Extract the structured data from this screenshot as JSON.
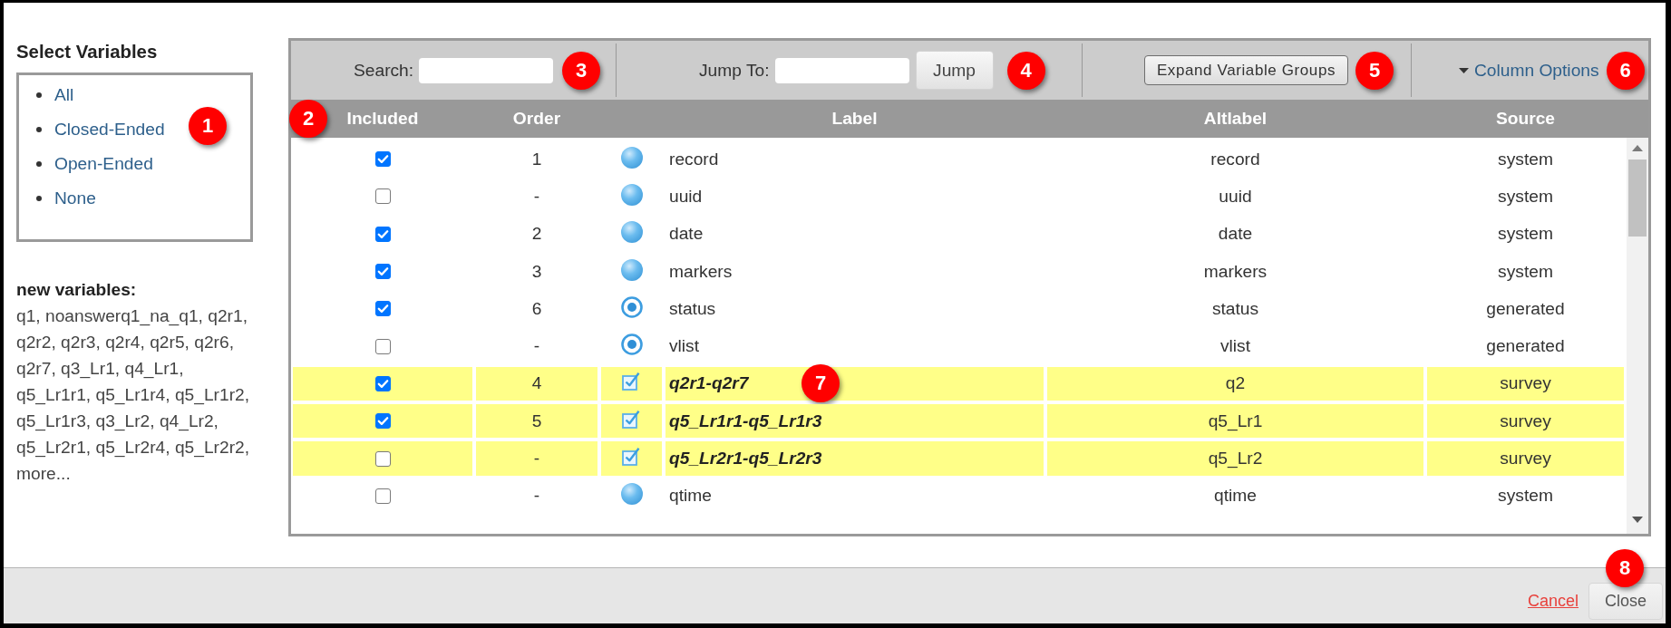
{
  "left_panel": {
    "title": "Select Variables",
    "filters": [
      "All",
      "Closed-Ended",
      "Open-Ended",
      "None"
    ],
    "callout": "1",
    "new_variables_title": "new variables:",
    "new_variables": "q1, noanswerq1_na_q1, q2r1, q2r2, q2r3, q2r4, q2r5, q2r6, q2r7, q3_Lr1, q4_Lr1, q5_Lr1r1, q5_Lr1r4, q5_Lr1r2, q5_Lr1r3, q3_Lr2, q4_Lr2, q5_Lr2r1, q5_Lr2r4, q5_Lr2r2, more..."
  },
  "toolbar": {
    "search": {
      "label": "Search:",
      "callout": "3"
    },
    "jump": {
      "label": "Jump To:",
      "button": "Jump",
      "callout": "4"
    },
    "expand_button": {
      "label": "Expand Variable Groups",
      "callout": "5"
    },
    "column_options": {
      "label": "Column Options",
      "callout": "6"
    }
  },
  "table": {
    "callout": "2",
    "columns": [
      "Included",
      "Order",
      "Label",
      "Altlabel",
      "Source"
    ],
    "rows": [
      {
        "included": true,
        "order": "1",
        "kind": "variable",
        "label": "record",
        "altlabel": "record",
        "source": "system"
      },
      {
        "included": false,
        "order": "-",
        "kind": "variable",
        "label": "uuid",
        "altlabel": "uuid",
        "source": "system"
      },
      {
        "included": true,
        "order": "2",
        "kind": "variable",
        "label": "date",
        "altlabel": "date",
        "source": "system"
      },
      {
        "included": true,
        "order": "3",
        "kind": "variable",
        "label": "markers",
        "altlabel": "markers",
        "source": "system"
      },
      {
        "included": true,
        "order": "6",
        "kind": "choice",
        "label": "status",
        "altlabel": "status",
        "source": "generated"
      },
      {
        "included": false,
        "order": "-",
        "kind": "choice",
        "label": "vlist",
        "altlabel": "vlist",
        "source": "generated"
      },
      {
        "included": true,
        "order": "4",
        "kind": "group",
        "label": "q2r1-q2r7",
        "altlabel": "q2",
        "source": "survey",
        "callout": "7"
      },
      {
        "included": true,
        "order": "5",
        "kind": "group",
        "label": "q5_Lr1r1-q5_Lr1r3",
        "altlabel": "q5_Lr1",
        "source": "survey"
      },
      {
        "included": false,
        "order": "-",
        "kind": "group",
        "label": "q5_Lr2r1-q5_Lr2r3",
        "altlabel": "q5_Lr2",
        "source": "survey"
      },
      {
        "included": false,
        "order": "-",
        "kind": "variable",
        "label": "qtime",
        "altlabel": "qtime",
        "source": "system"
      }
    ]
  },
  "footer": {
    "cancel": "Cancel",
    "close": "Close",
    "callout": "8"
  }
}
